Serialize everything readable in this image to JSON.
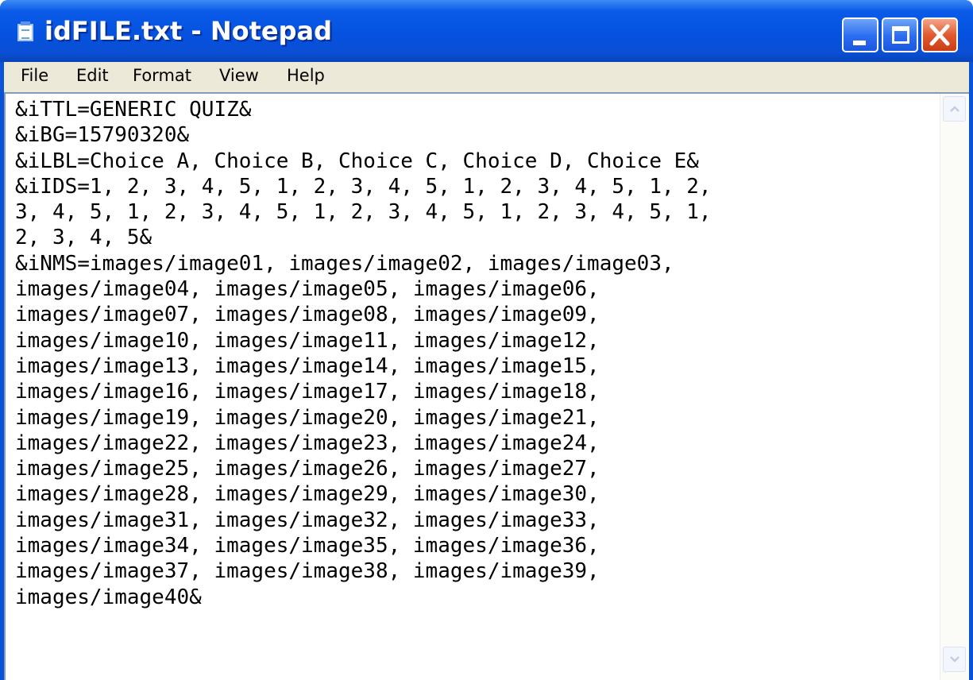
{
  "window": {
    "title": "idFILE.txt - Notepad"
  },
  "menu": {
    "file": "File",
    "edit": "Edit",
    "format": "Format",
    "view": "View",
    "help": "Help"
  },
  "document": {
    "content": "&iTTL=GENERIC QUIZ&\n&iBG=15790320&\n&iLBL=Choice A, Choice B, Choice C, Choice D, Choice E&\n&iIDS=1, 2, 3, 4, 5, 1, 2, 3, 4, 5, 1, 2, 3, 4, 5, 1, 2,\n3, 4, 5, 1, 2, 3, 4, 5, 1, 2, 3, 4, 5, 1, 2, 3, 4, 5, 1,\n2, 3, 4, 5&\n&iNMS=images/image01, images/image02, images/image03,\nimages/image04, images/image05, images/image06,\nimages/image07, images/image08, images/image09,\nimages/image10, images/image11, images/image12,\nimages/image13, images/image14, images/image15,\nimages/image16, images/image17, images/image18,\nimages/image19, images/image20, images/image21,\nimages/image22, images/image23, images/image24,\nimages/image25, images/image26, images/image27,\nimages/image28, images/image29, images/image30,\nimages/image31, images/image32, images/image33,\nimages/image34, images/image35, images/image36,\nimages/image37, images/image38, images/image39,\nimages/image40&"
  },
  "icons": {
    "app": "notepad-icon",
    "minimize": "minimize-icon",
    "maximize": "maximize-icon",
    "close": "close-icon",
    "scroll_up": "chevron-up-icon",
    "scroll_down": "chevron-down-icon"
  },
  "colors": {
    "titlebar": "#0552e0",
    "close_button": "#e25a30",
    "menubar": "#ece9d8"
  }
}
